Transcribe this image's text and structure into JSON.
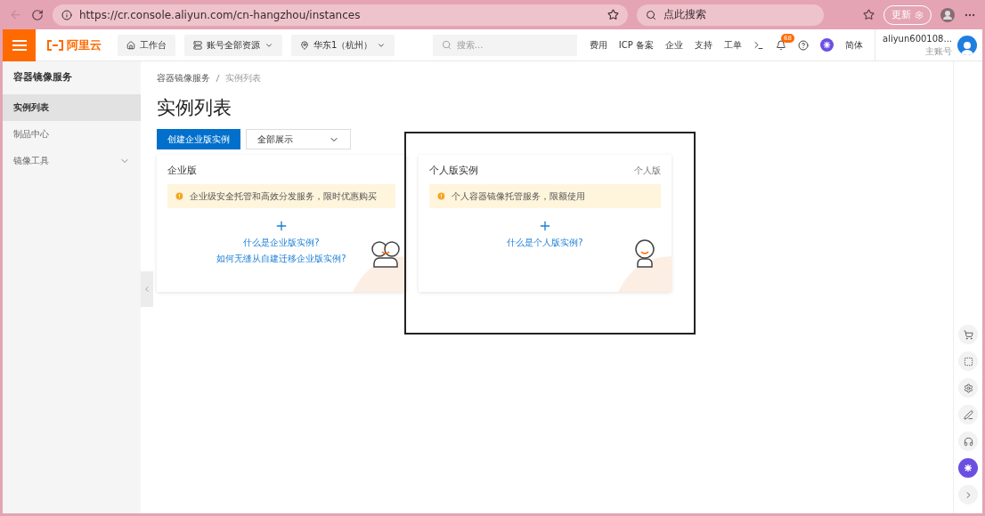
{
  "browser": {
    "url": "https://cr.console.aliyun.com/cn-hangzhou/instances",
    "search_placeholder": "点此搜索",
    "update_button": "更新"
  },
  "header": {
    "logo": "阿里云",
    "nav": [
      {
        "label": "工作台",
        "kind": "home"
      },
      {
        "label": "账号全部资源",
        "kind": "dropdown"
      },
      {
        "label": "华东1（杭州）",
        "kind": "region"
      }
    ],
    "search_placeholder": "搜索...",
    "links": [
      "费用",
      "ICP 备案",
      "企业",
      "支持",
      "工单"
    ],
    "notification_count": "68",
    "language": "简体",
    "user": {
      "name": "aliyun600108...",
      "role": "主账号"
    }
  },
  "sidebar": {
    "title": "容器镜像服务",
    "items": [
      {
        "label": "实例列表",
        "selected": true,
        "kind": "link"
      },
      {
        "label": "制品中心",
        "selected": false,
        "kind": "link"
      },
      {
        "label": "镜像工具",
        "selected": false,
        "kind": "group"
      }
    ]
  },
  "main": {
    "breadcrumb": [
      "容器镜像服务",
      "实例列表"
    ],
    "title": "实例列表",
    "create_button": "创建企业版实例",
    "filter": {
      "value": "全部展示"
    },
    "cards": [
      {
        "kind": "enterprise",
        "title": "企业版",
        "notice": "企业级安全托管和高效分发服务，限时优惠购买",
        "links": [
          "什么是企业版实例?",
          "如何无缝从自建迁移企业版实例?"
        ],
        "highlighted": false
      },
      {
        "kind": "personal",
        "title": "个人版实例",
        "tag": "个人版",
        "notice": "个人容器镜像托管服务，限额使用",
        "links": [
          "什么是个人版实例?"
        ],
        "highlighted": true
      }
    ]
  }
}
